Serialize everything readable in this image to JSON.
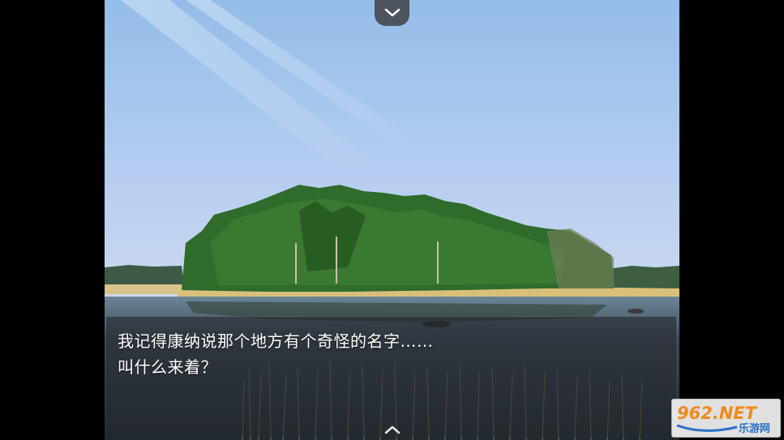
{
  "dialog": {
    "line1": "我记得康纳说那个地方有个奇怪的名字……",
    "line2": "叫什么来着？"
  },
  "watermark": {
    "text": "962.NET",
    "subtext": "乐游网"
  },
  "icons": {
    "top_handle": "chevron-down-icon",
    "bottom_handle": "chevron-up-icon"
  },
  "colors": {
    "sky_top": "#9cc4ee",
    "sky_bottom": "#c8d8f0",
    "water": "#4a5a68",
    "grass": "#d9c07a",
    "trees": "#2f6b2a",
    "dialog_bg": "#26282e",
    "watermark_orange": "#f08a1c",
    "watermark_blue": "#2a6fc8"
  }
}
